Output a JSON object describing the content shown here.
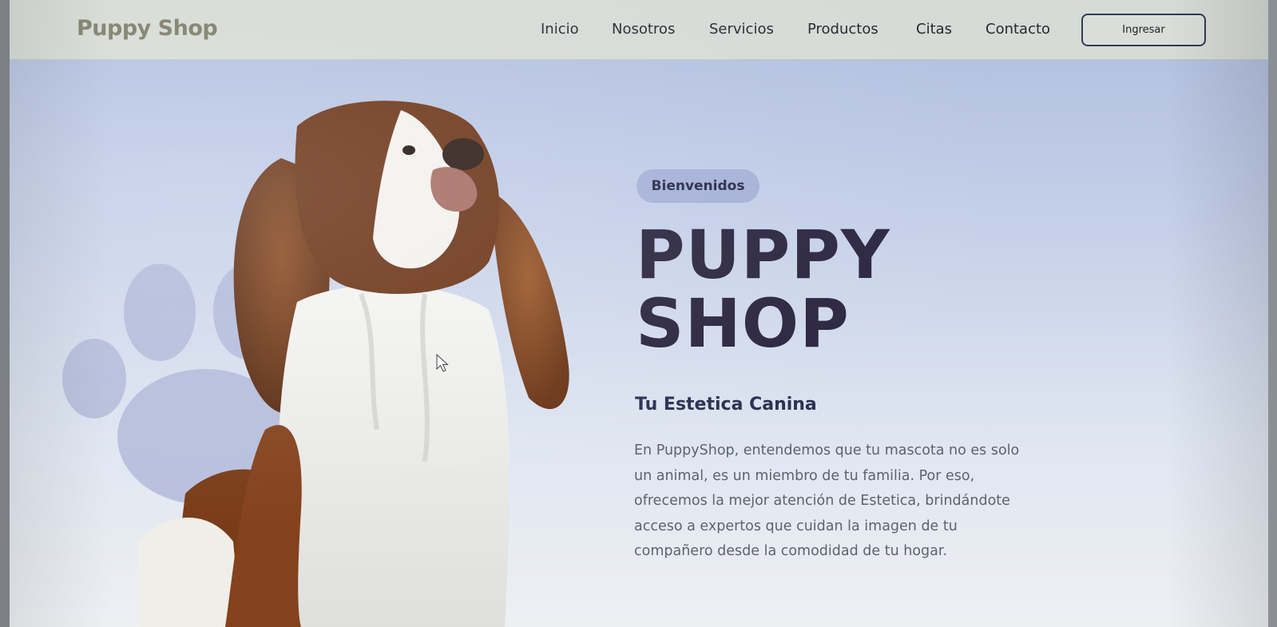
{
  "nav": {
    "brand": "Puppy Shop",
    "items": [
      {
        "label": "Inicio"
      },
      {
        "label": "Nosotros"
      },
      {
        "label": "Servicios"
      },
      {
        "label": "Productos"
      },
      {
        "label": "Citas"
      },
      {
        "label": "Contacto"
      }
    ],
    "login_label": "Ingresar"
  },
  "hero": {
    "badge": "Bienvenidos",
    "title_line1": "PUPPY",
    "title_line2": "SHOP",
    "subtitle": "Tu Estetica Canina",
    "description": "En PuppyShop, entendemos que tu mascota no es solo un animal, es un miembro de tu familia. Por eso, ofrecemos la mejor atención de Estetica, brindándote acceso a expertos que cuidan la imagen de tu compañero desde la comodidad de tu hogar."
  },
  "icons": {
    "paw": "paw-print-icon",
    "cursor": "mouse-cursor-icon"
  },
  "colors": {
    "nav_bg": "#d6dbd6",
    "brand": "#7c7c68",
    "title": "#2a2440",
    "badge_bg": "#a4b0d7",
    "button_border": "#2f3a5a"
  }
}
